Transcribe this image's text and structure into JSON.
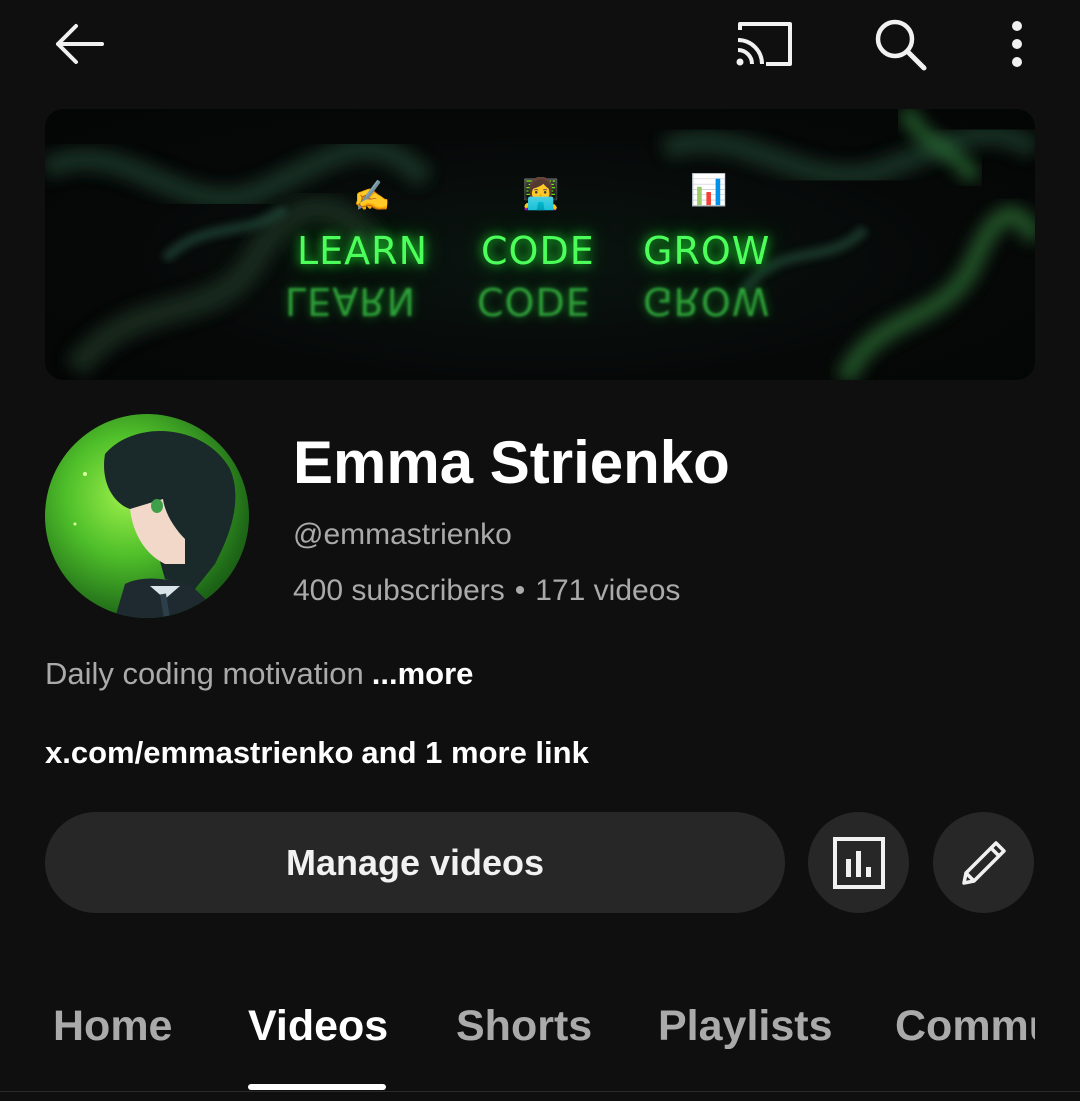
{
  "topbar": {
    "back_icon": "back-arrow-icon",
    "cast_icon": "cast-icon",
    "search_icon": "search-icon",
    "more_icon": "more-vertical-icon"
  },
  "banner": {
    "words": [
      "LEARN",
      "CODE",
      "GROW"
    ],
    "emojis": [
      "✍",
      "👩‍💻",
      "📊"
    ],
    "accent_color": "#4dff5a"
  },
  "channel": {
    "name": "Emma Strienko",
    "handle": "@emmastrienko",
    "subscribers": "400 subscribers",
    "separator": "•",
    "videos": "171 videos",
    "description": "Daily coding motivation",
    "description_more": "...more",
    "link_url": "x.com/emmastrienko",
    "link_more": "and 1 more link"
  },
  "actions": {
    "manage_label": "Manage videos",
    "analytics_icon": "analytics-icon",
    "edit_icon": "pencil-icon"
  },
  "tabs": [
    {
      "label": "Home",
      "active": false
    },
    {
      "label": "Videos",
      "active": true
    },
    {
      "label": "Shorts",
      "active": false
    },
    {
      "label": "Playlists",
      "active": false
    },
    {
      "label": "Commu",
      "active": false
    }
  ],
  "colors": {
    "background": "#0f0f0f",
    "button_bg": "#272727",
    "secondary_text": "#aaaaaa",
    "primary_text": "#ffffff"
  }
}
